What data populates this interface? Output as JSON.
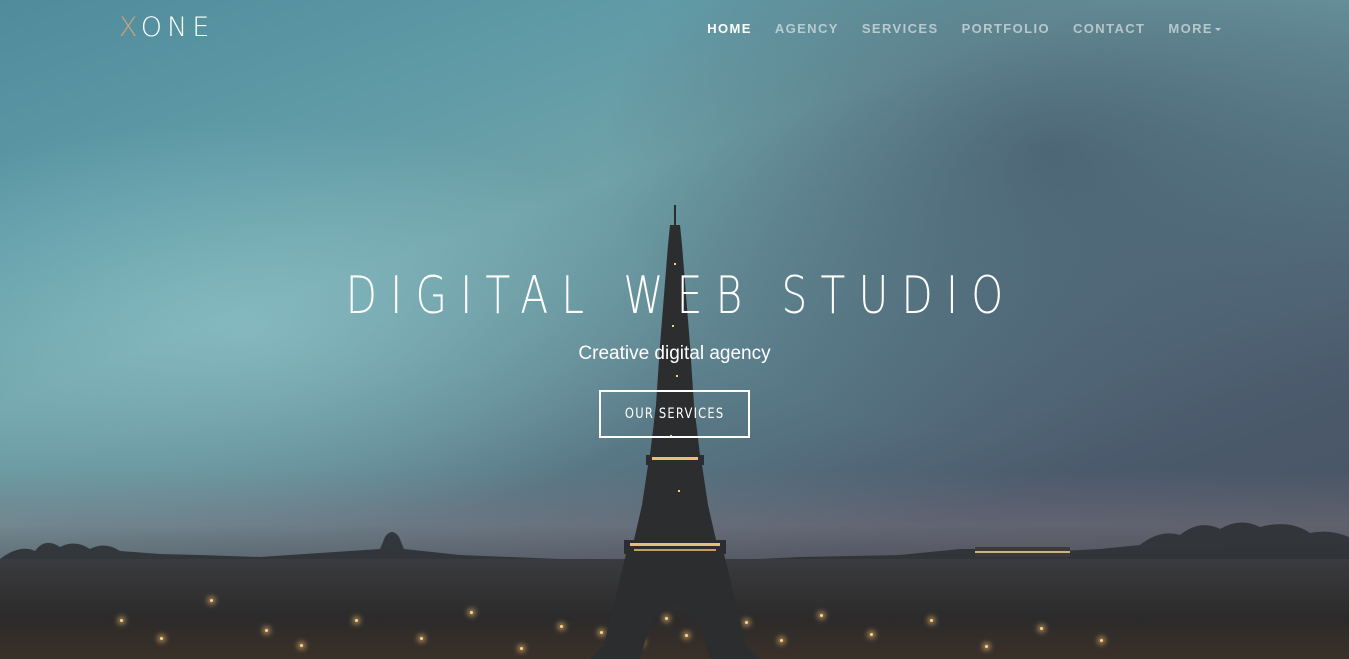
{
  "brand": {
    "accent_letter": "X",
    "rest": "ONE",
    "accent_color": "#c9a37a"
  },
  "nav": {
    "items": [
      {
        "label": "HOME",
        "active": true
      },
      {
        "label": "AGENCY",
        "active": false
      },
      {
        "label": "SERVICES",
        "active": false
      },
      {
        "label": "PORTFOLIO",
        "active": false
      },
      {
        "label": "CONTACT",
        "active": false
      },
      {
        "label": "MORE",
        "active": false,
        "icon": "caret-down-icon"
      }
    ]
  },
  "hero": {
    "title": "DIGITAL WEB STUDIO",
    "subtitle": "Creative digital agency",
    "button_label": "OUR SERVICES",
    "background": "eiffel-tower-dusk-photo"
  }
}
